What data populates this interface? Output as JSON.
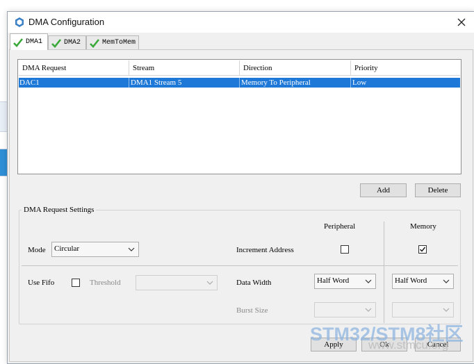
{
  "window": {
    "title": "DMA Configuration"
  },
  "tabs": [
    {
      "label": "DMA1",
      "active": true
    },
    {
      "label": "DMA2",
      "active": false
    },
    {
      "label": "MemToMem",
      "active": false
    }
  ],
  "table": {
    "headers": [
      "DMA Request",
      "Stream",
      "Direction",
      "Priority"
    ],
    "rows": [
      {
        "request": "DAC1",
        "stream": "DMA1 Stream 5",
        "direction": "Memory To Peripheral",
        "priority": "Low",
        "selected": true
      }
    ]
  },
  "buttons": {
    "add": "Add",
    "delete": "Delete",
    "apply": "Apply",
    "ok": "Ok",
    "cancel": "Cancel"
  },
  "settings": {
    "title": "DMA Request Settings",
    "col_peripheral": "Peripheral",
    "col_memory": "Memory",
    "mode_label": "Mode",
    "mode_value": "Circular",
    "increment_label": "Increment Address",
    "increment_peripheral": false,
    "increment_memory": true,
    "use_fifo_label": "Use Fifo",
    "use_fifo": false,
    "threshold_label": "Threshold",
    "threshold_value": "",
    "data_width_label": "Data Width",
    "data_width_peripheral": "Half Word",
    "data_width_memory": "Half Word",
    "burst_size_label": "Burst Size",
    "burst_peripheral": "",
    "burst_memory": ""
  },
  "watermark": {
    "brand": "STM32/STM8社区",
    "url": "www.stmcu.org"
  },
  "colors": {
    "selection": "#1e78d7",
    "check_green": "#3aa93a"
  }
}
